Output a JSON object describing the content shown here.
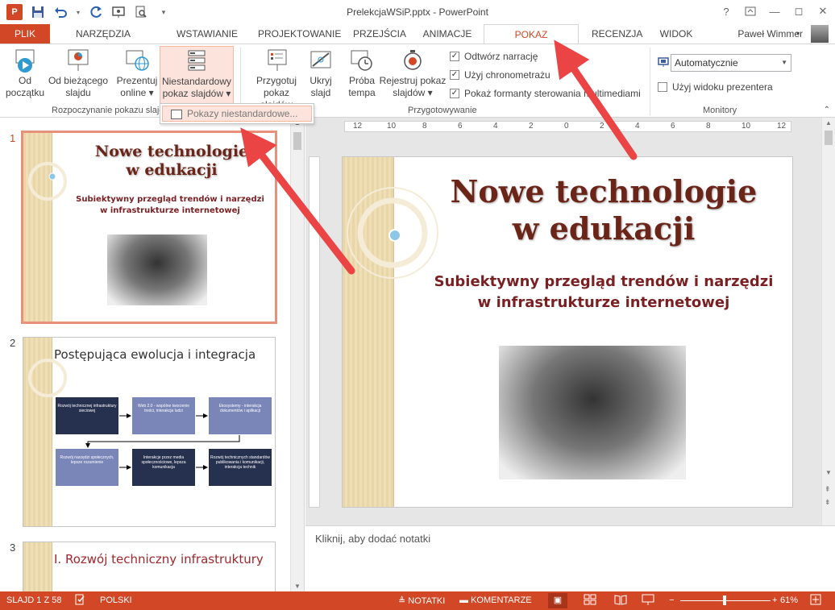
{
  "window": {
    "title": "PrelekcjaWSiP.pptx - PowerPoint",
    "app_icon_label": "P",
    "help": "?",
    "controls": [
      "—",
      "◻",
      "✕"
    ]
  },
  "quick_access": [
    "save-icon",
    "undo-icon",
    "redo-icon",
    "start-from-beginning-icon",
    "print-preview-icon",
    "customize-icon"
  ],
  "tabs": [
    "PLIK",
    "NARZĘDZIA GŁÓWNE",
    "WSTAWIANIE",
    "PROJEKTOWANIE",
    "PRZEJŚCIA",
    "ANIMACJE",
    "POKAZ SLAJDÓW",
    "RECENZJA",
    "WIDOK"
  ],
  "active_tab": "POKAZ SLAJDÓW",
  "user_name": "Paweł Wimmer",
  "ribbon": {
    "groups": {
      "start": "Rozpoczynanie pokazu slajdów",
      "setup": "Przygotowywanie",
      "monitors": "Monitory"
    },
    "buttons": {
      "from_beginning": [
        "Od",
        "początku"
      ],
      "from_current": [
        "Od bieżącego",
        "slajdu"
      ],
      "present_online": [
        "Prezentuj",
        "online ▾"
      ],
      "custom_show": [
        "Niestandardowy",
        "pokaz slajdów ▾"
      ],
      "setup_show": [
        "Przygotuj",
        "pokaz slajdów"
      ],
      "hide_slide": [
        "Ukryj",
        "slajd"
      ],
      "rehearse": [
        "Próba",
        "tempa"
      ],
      "record": [
        "Rejestruj pokaz",
        "slajdów ▾"
      ]
    },
    "checkboxes": {
      "play_narration": "Odtwórz narrację",
      "use_timings": "Użyj chronometrażu",
      "show_media_controls": "Pokaż formanty sterowania multimediami"
    },
    "monitor_select": "Automatycznie",
    "presenter_view": "Użyj widoku prezentera"
  },
  "dropdown": {
    "item": "Pokazy niestandardowe..."
  },
  "thumbnails": [
    {
      "number": "1",
      "title": "Nowe technologie\nw edukacji",
      "subtitle": "Subiektywny przegląd trendów i narzędzi\nw infrastrukturze internetowej"
    },
    {
      "number": "2",
      "title": "Postępująca ewolucja i integracja",
      "boxes": [
        "Rozwój technicznej infrastruktury sieciowej",
        "Web 2.0 - wspólne tworzenie treści, interakcja ludzi",
        "Ekosystemy - interakcja dokumentów i aplikacji",
        "Rozwój narzędzi społecznych, lepsze rozumienie",
        "Interakcje przez media społecznościowe, lepsza komunikacja",
        "Rozwój technicznych standardów publikowania i komunikacji, interakcja technik"
      ]
    },
    {
      "number": "3",
      "title": "I. Rozwój techniczny infrastruktury"
    }
  ],
  "main_slide": {
    "title": "Nowe technologie\nw edukacji",
    "subtitle": "Subiektywny przegląd trendów i narzędzi\nw infrastrukturze internetowej"
  },
  "ruler": {
    "h_labels": [
      "12",
      "10",
      "8",
      "6",
      "4",
      "2",
      "0",
      "2",
      "4",
      "6",
      "8",
      "10",
      "12"
    ]
  },
  "notes_placeholder": "Kliknij, aby dodać notatki",
  "status": {
    "slide_info": "SLAJD 1 Z 58",
    "language": "POLSKI",
    "notes": "NOTATKI",
    "comments": "KOMENTARZE",
    "zoom": "61%",
    "zoom_level": 0.61
  },
  "colors": {
    "accent": "#d24726",
    "title_text": "#6b2418",
    "subtitle_text": "#7a1f22",
    "diagram_box": "#7a86b8",
    "diagram_box_dark": "#26304f",
    "arrow": "#ea4444"
  }
}
